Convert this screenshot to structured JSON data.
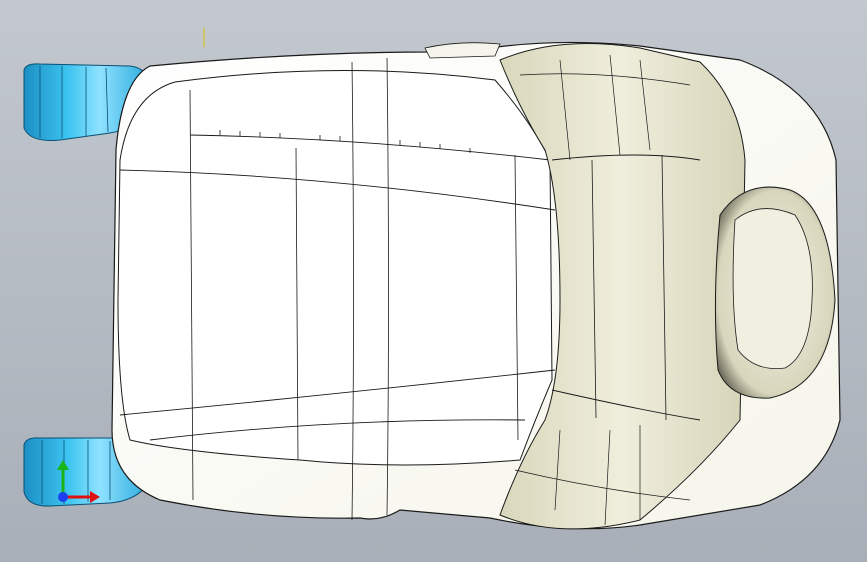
{
  "viewport": {
    "background_top": "#c3c8cf",
    "background_bottom": "#a9afb8"
  },
  "model": {
    "subject": "car-seat-cushion-top-view",
    "surface_color": "#fbfbf3",
    "bolster_color": "#e9e8d3",
    "mount_color": "#2fb6e6",
    "edge_color": "#1a1a1a"
  },
  "triad": {
    "x_axis_color": "#e01010",
    "y_axis_color": "#18b418",
    "z_axis_color": "#1c3ff0"
  }
}
